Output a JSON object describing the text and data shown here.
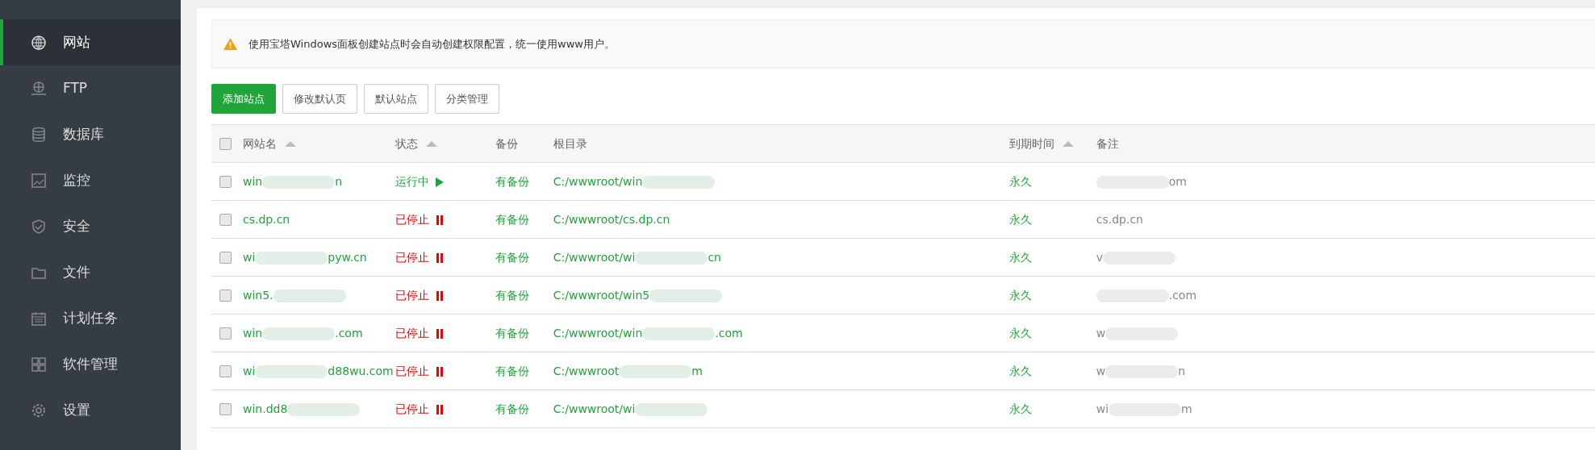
{
  "sidebar": {
    "items": [
      {
        "label": "网站",
        "selected": true
      },
      {
        "label": "FTP",
        "selected": false
      },
      {
        "label": "数据库",
        "selected": false
      },
      {
        "label": "监控",
        "selected": false
      },
      {
        "label": "安全",
        "selected": false
      },
      {
        "label": "文件",
        "selected": false
      },
      {
        "label": "计划任务",
        "selected": false
      },
      {
        "label": "软件管理",
        "selected": false
      },
      {
        "label": "设置",
        "selected": false
      }
    ]
  },
  "notice": "使用宝塔Windows面板创建站点时会自动创建权限配置，统一使用www用户。",
  "buttons": [
    {
      "label": "添加站点",
      "kind": "primary"
    },
    {
      "label": "修改默认页",
      "kind": "default"
    },
    {
      "label": "默认站点",
      "kind": "default"
    },
    {
      "label": "分类管理",
      "kind": "default"
    }
  ],
  "table": {
    "select_all": {
      "checked": false
    },
    "columns": [
      {
        "label": "网站名",
        "sortable": true
      },
      {
        "label": "状态",
        "sortable": true
      },
      {
        "label": "备份",
        "sortable": false
      },
      {
        "label": "根目录",
        "sortable": false
      },
      {
        "label": "到期时间",
        "sortable": true
      },
      {
        "label": "备注",
        "sortable": false
      }
    ],
    "rows": [
      {
        "checked": false,
        "name": [
          {
            "text": "win"
          },
          {
            "kind": "blur"
          },
          {
            "text": "n"
          }
        ],
        "status": "运行中",
        "running": true,
        "backup": "有备份",
        "root": [
          {
            "text": "C:/wwwroot/win"
          },
          {
            "kind": "blur"
          }
        ],
        "expiry": "永久",
        "note": [
          {
            "kind": "blur"
          },
          {
            "text": "om"
          }
        ]
      },
      {
        "checked": false,
        "name": [
          {
            "text": "cs.dp.cn"
          }
        ],
        "status": "已停止",
        "running": false,
        "backup": "有备份",
        "root": [
          {
            "text": "C:/wwwroot/cs.dp.cn"
          }
        ],
        "expiry": "永久",
        "note": [
          {
            "text": "cs.dp.cn"
          }
        ]
      },
      {
        "checked": false,
        "name": [
          {
            "text": "wi"
          },
          {
            "kind": "blur"
          },
          {
            "text": "pyw.cn"
          }
        ],
        "status": "已停止",
        "running": false,
        "backup": "有备份",
        "root": [
          {
            "text": "C:/wwwroot/wi"
          },
          {
            "kind": "blur"
          },
          {
            "text": "cn"
          }
        ],
        "expiry": "永久",
        "note": [
          {
            "text": "v"
          },
          {
            "kind": "blur"
          }
        ]
      },
      {
        "checked": false,
        "name": [
          {
            "text": "win5."
          },
          {
            "kind": "blur"
          }
        ],
        "status": "已停止",
        "running": false,
        "backup": "有备份",
        "root": [
          {
            "text": "C:/wwwroot/win5"
          },
          {
            "kind": "blur"
          }
        ],
        "expiry": "永久",
        "note": [
          {
            "kind": "blur"
          },
          {
            "text": ".com"
          }
        ]
      },
      {
        "checked": false,
        "name": [
          {
            "text": "win"
          },
          {
            "kind": "blur"
          },
          {
            "text": ".com"
          }
        ],
        "status": "已停止",
        "running": false,
        "backup": "有备份",
        "root": [
          {
            "text": "C:/wwwroot/win"
          },
          {
            "kind": "blur"
          },
          {
            "text": ".com"
          }
        ],
        "expiry": "永久",
        "note": [
          {
            "text": "w"
          },
          {
            "kind": "blur"
          }
        ]
      },
      {
        "checked": false,
        "name": [
          {
            "text": "wi"
          },
          {
            "kind": "blur"
          },
          {
            "text": "d88wu.com"
          }
        ],
        "status": "已停止",
        "running": false,
        "backup": "有备份",
        "root": [
          {
            "text": "C:/wwwroot"
          },
          {
            "kind": "blur"
          },
          {
            "text": "m"
          }
        ],
        "expiry": "永久",
        "note": [
          {
            "text": "w"
          },
          {
            "kind": "blur"
          },
          {
            "text": "n"
          }
        ]
      },
      {
        "checked": false,
        "name": [
          {
            "text": "win.dd8"
          },
          {
            "kind": "blur"
          }
        ],
        "status": "已停止",
        "running": false,
        "backup": "有备份",
        "root": [
          {
            "text": "C:/wwwroot/wi"
          },
          {
            "kind": "blur"
          }
        ],
        "expiry": "永久",
        "note": [
          {
            "text": "wi"
          },
          {
            "kind": "blur"
          },
          {
            "text": "m"
          }
        ]
      }
    ]
  }
}
